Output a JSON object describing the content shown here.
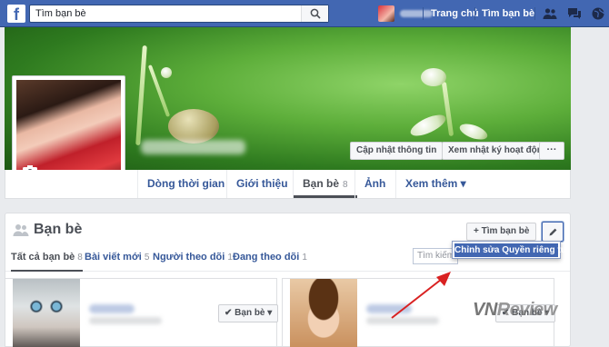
{
  "topbar": {
    "logo": "f",
    "search_value": "Tìm bạn bè",
    "nav": [
      "Trang chủ",
      "Tìm bạn bè"
    ],
    "icons": [
      "friend-requests-icon",
      "messages-icon",
      "globe-icon"
    ]
  },
  "cover": {
    "update_info_label": "Cập nhật thông tin",
    "activity_log_label": "Xem nhật ký hoạt động",
    "more_label": "···"
  },
  "profile_nav": {
    "tabs": [
      {
        "label": "Dòng thời gian"
      },
      {
        "label": "Giới thiệu"
      },
      {
        "label": "Bạn bè",
        "count": "8"
      },
      {
        "label": "Ảnh"
      },
      {
        "label": "Xem thêm ▾"
      }
    ]
  },
  "friends": {
    "title": "Bạn bè",
    "find_label": "+ Tìm bạn bè",
    "filters": [
      {
        "label": "Tất cả bạn bè",
        "count": "8"
      },
      {
        "label": "Bài viết mới",
        "count": "5"
      },
      {
        "label": "Người theo dõi",
        "count": "1"
      },
      {
        "label": "Đang theo dõi",
        "count": "1"
      }
    ],
    "search_placeholder": "Tìm kiếm",
    "dropdown_item": "Chỉnh sửa Quyền riêng tư",
    "cards": [
      {
        "button": "✔ Bạn bè ▾"
      },
      {
        "button": "✔ Bạn bè ▾"
      }
    ]
  },
  "watermark": {
    "vn": "VN",
    "rest": "Review"
  }
}
